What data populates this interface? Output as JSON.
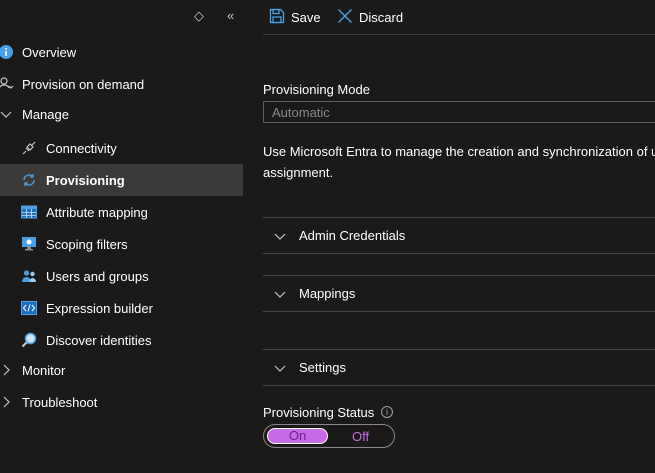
{
  "sidebar": {
    "items": [
      {
        "label": "Overview",
        "icon": "info-icon"
      },
      {
        "label": "Provision on demand",
        "icon": "person-sync-icon"
      },
      {
        "label": "Manage",
        "icon": "chevron-down-icon"
      },
      {
        "label": "Connectivity",
        "icon": "plug-icon"
      },
      {
        "label": "Provisioning",
        "icon": "sync-icon"
      },
      {
        "label": "Attribute mapping",
        "icon": "table-icon"
      },
      {
        "label": "Scoping filters",
        "icon": "monitor-filter-icon"
      },
      {
        "label": "Users and groups",
        "icon": "users-icon"
      },
      {
        "label": "Expression builder",
        "icon": "code-icon"
      },
      {
        "label": "Discover identities",
        "icon": "magnifier-icon"
      },
      {
        "label": "Monitor",
        "icon": "chevron-right-icon"
      },
      {
        "label": "Troubleshoot",
        "icon": "chevron-right-icon"
      }
    ],
    "selected": "Provisioning"
  },
  "toolbar": {
    "save_label": "Save",
    "discard_label": "Discard"
  },
  "main": {
    "mode_label": "Provisioning Mode",
    "mode_value": "Automatic",
    "description": "Use Microsoft Entra to manage the creation and synchronization of u assignment.",
    "sections": [
      {
        "label": "Admin Credentials"
      },
      {
        "label": "Mappings"
      },
      {
        "label": "Settings"
      }
    ],
    "status_label": "Provisioning Status",
    "toggle": {
      "on_label": "On",
      "off_label": "Off",
      "selected": "On"
    }
  },
  "colors": {
    "background": "#1b1a19",
    "selected_nav": "#3b3a39",
    "accent_blue": "#4aa0e6",
    "toggle_purple": "#c86ae8"
  }
}
